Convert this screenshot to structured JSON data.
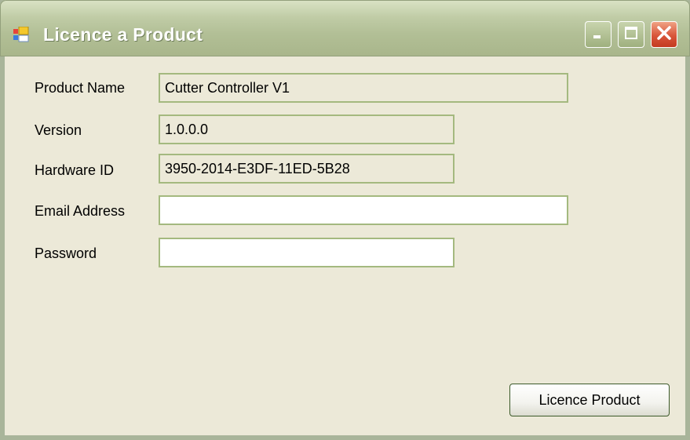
{
  "window": {
    "title": "Licence a Product",
    "icon": "app-window-icon",
    "controls": [
      "minimize-icon",
      "maximize-icon",
      "close-icon"
    ]
  },
  "form": {
    "product_name": {
      "label": "Product Name",
      "value": "Cutter Controller V1"
    },
    "version": {
      "label": "Version",
      "value": "1.0.0.0"
    },
    "hardware_id": {
      "label": "Hardware ID",
      "value": "3950-2014-E3DF-11ED-5B28"
    },
    "email": {
      "label": "Email Address",
      "value": ""
    },
    "password": {
      "label": "Password",
      "value": ""
    }
  },
  "actions": {
    "licence_label": "Licence Product"
  },
  "colors": {
    "window_bg": "#ece9d8",
    "title_bar": "#b2bf96",
    "field_border": "#a4b97f",
    "close_button": "#d8553a"
  }
}
